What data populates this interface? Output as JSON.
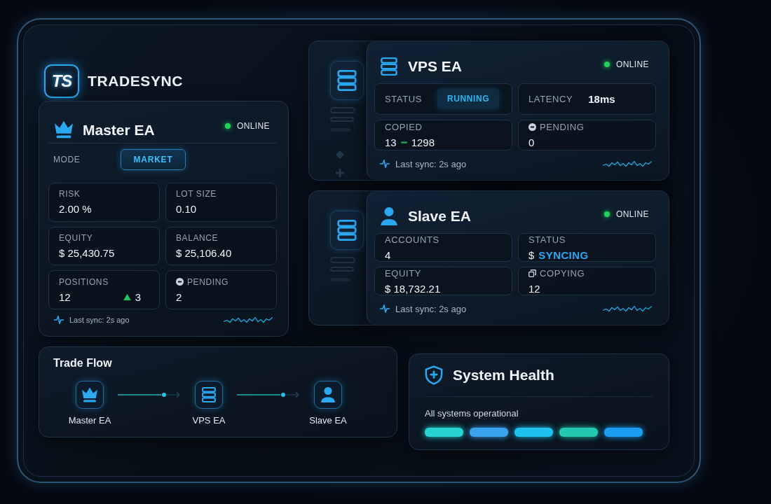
{
  "brand": {
    "logo": "TS",
    "name": "TRADESYNC"
  },
  "master": {
    "title": "Master EA",
    "status": {
      "label": "ONLINE",
      "online": true
    },
    "mode": {
      "label": "MODE",
      "value": "MARKET"
    },
    "stats": [
      {
        "kind": "value",
        "label": "RISK",
        "value": "2.00 %"
      },
      {
        "kind": "value",
        "label": "LOT SIZE",
        "value": "0.10"
      },
      {
        "kind": "value",
        "label": "EQUITY",
        "value": "$ 25,430.75"
      },
      {
        "kind": "value",
        "label": "BALANCE",
        "value": "$ 25,106.40"
      },
      {
        "kind": "value",
        "label": "POSITIONS",
        "value": "12",
        "change": "3"
      },
      {
        "kind": "value",
        "label": "PENDING",
        "value": "2"
      }
    ],
    "last_sync": "Last sync: 2s ago"
  },
  "vps": {
    "title": "VPS EA",
    "status": {
      "label": "ONLINE",
      "online": true
    },
    "stats": [
      {
        "kind": "badge",
        "label": "STATUS",
        "value": "RUNNING"
      },
      {
        "kind": "inline",
        "label": "LATENCY",
        "value": "18ms"
      },
      {
        "kind": "pair",
        "label": "COPIED",
        "value": "13",
        "value_2": "1298"
      },
      {
        "kind": "value",
        "label": "PENDING",
        "value": "0"
      }
    ],
    "last_sync": "Last sync: 2s ago"
  },
  "slave": {
    "title": "Slave EA",
    "status": {
      "label": "ONLINE",
      "online": true
    },
    "stats": [
      {
        "kind": "value",
        "label": "ACCOUNTS",
        "value": "4"
      },
      {
        "kind": "status",
        "label": "STATUS",
        "prefix": "$",
        "value": "SYNCING"
      },
      {
        "kind": "value",
        "label": "EQUITY",
        "value": "$ 18,732.21"
      },
      {
        "kind": "value",
        "label": "COPYING",
        "value": "12"
      }
    ],
    "last_sync": "Last sync: 2s ago"
  },
  "trade_flow": {
    "title": "Trade Flow",
    "nodes": [
      {
        "label": "Master EA"
      },
      {
        "label": "VPS EA"
      },
      {
        "label": "Slave EA"
      }
    ]
  },
  "system_health": {
    "title": "System Health",
    "message": "All systems operational",
    "segments": [
      {
        "color": "#26d3cf"
      },
      {
        "color": "#3aa3f0"
      },
      {
        "color": "#1fc2ee"
      },
      {
        "color": "#22c8b0"
      },
      {
        "color": "#1b9ef2"
      }
    ]
  }
}
